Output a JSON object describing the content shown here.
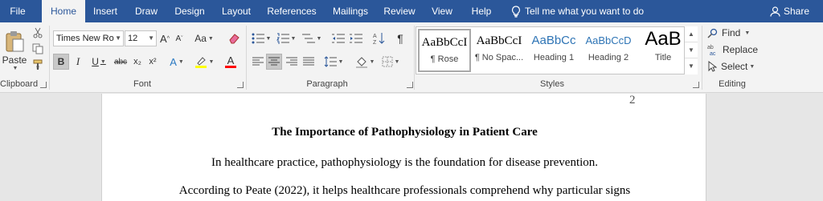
{
  "tabs": [
    "File",
    "Home",
    "Insert",
    "Draw",
    "Design",
    "Layout",
    "References",
    "Mailings",
    "Review",
    "View",
    "Help"
  ],
  "tell_me": "Tell me what you want to do",
  "share": "Share",
  "clipboard": {
    "paste_label": "Paste",
    "group_label": "Clipboard"
  },
  "font": {
    "name": "Times New Ro",
    "size": "12",
    "case_label": "Aa",
    "group_label": "Font",
    "bold": "B",
    "italic": "I",
    "underline": "U",
    "strike": "abc",
    "sub": "x₂",
    "super": "x²",
    "effects": "A"
  },
  "paragraph": {
    "group_label": "Paragraph",
    "marks": "¶"
  },
  "styles": {
    "group_label": "Styles",
    "items": [
      {
        "sample": "AaBbCcI",
        "name": "¶ Rose"
      },
      {
        "sample": "AaBbCcI",
        "name": "¶ No Spac..."
      },
      {
        "sample": "AaBbCc",
        "name": "Heading 1"
      },
      {
        "sample": "AaBbCcD",
        "name": "Heading 2"
      },
      {
        "sample": "AaB",
        "name": "Title"
      }
    ]
  },
  "editing": {
    "find": "Find",
    "replace": "Replace",
    "select": "Select",
    "group_label": "Editing"
  },
  "document": {
    "page_number": "2",
    "title": "The Importance of Pathophysiology in Patient Care",
    "paragraph1": "In healthcare practice, pathophysiology is the foundation for disease prevention.",
    "paragraph2": "According to Peate (2022), it helps healthcare professionals comprehend why particular signs"
  },
  "colors": {
    "brand": "#2b579a",
    "highlight": "#ffff00",
    "font_color": "#ff0000"
  }
}
